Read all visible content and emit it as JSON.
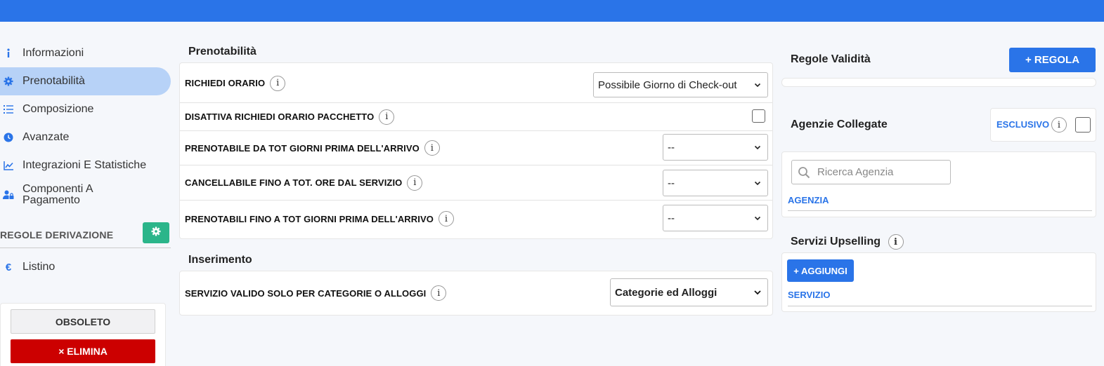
{
  "sidebar": {
    "items": [
      {
        "label": "Informazioni",
        "icon": "info-icon",
        "active": false
      },
      {
        "label": "Prenotabilità",
        "icon": "gear-icon",
        "active": true
      },
      {
        "label": "Composizione",
        "icon": "list-icon",
        "active": false
      },
      {
        "label": "Avanzate",
        "icon": "clock-icon",
        "active": false
      },
      {
        "label": "Integrazioni E Statistiche",
        "icon": "chart-line-icon",
        "active": false
      },
      {
        "label": "Componenti A Pagamento",
        "icon": "user-lock-icon",
        "active": false
      }
    ],
    "derivation_label": "REGOLE DERIVAZIONE",
    "listino_label": "Listino",
    "obsoleto_label": "OBSOLETO",
    "elimina_label": "× ELIMINA"
  },
  "prenotabilita": {
    "title": "Prenotabilità",
    "rows": [
      {
        "label": "RICHIEDI ORARIO",
        "control": "select",
        "value": "Possibile Giorno di Check-out"
      },
      {
        "label": "DISATTIVA RICHIEDI ORARIO PACCHETTO",
        "control": "checkbox",
        "checked": false
      },
      {
        "label": "PRENOTABILE DA TOT GIORNI PRIMA DELL'ARRIVO",
        "control": "select",
        "value": "--"
      },
      {
        "label": "CANCELLABILE FINO A TOT. ORE DAL SERVIZIO",
        "control": "select",
        "value": "--"
      },
      {
        "label": "PRENOTABILI FINO A TOT GIORNI PRIMA DELL'ARRIVO",
        "control": "select",
        "value": "--"
      }
    ]
  },
  "inserimento": {
    "title": "Inserimento",
    "row": {
      "label": "SERVIZIO VALIDO SOLO PER CATEGORIE O ALLOGGI",
      "value": "Categorie ed Alloggi"
    }
  },
  "right": {
    "regole_title": "Regole Validità",
    "regola_button": "+ REGOLA",
    "agenzie_title": "Agenzie Collegate",
    "esclusivo_label": "ESCLUSIVO",
    "search_placeholder": "Ricerca Agenzia",
    "agenzia_header": "AGENZIA",
    "upselling_title": "Servizi Upselling",
    "aggiungi_button": "+ AGGIUNGI",
    "servizio_header": "SERVIZIO"
  },
  "colors": {
    "primary": "#2a74e8",
    "danger": "#cc0000",
    "success": "#2bb58a",
    "active_bg": "#b7d2f7"
  }
}
